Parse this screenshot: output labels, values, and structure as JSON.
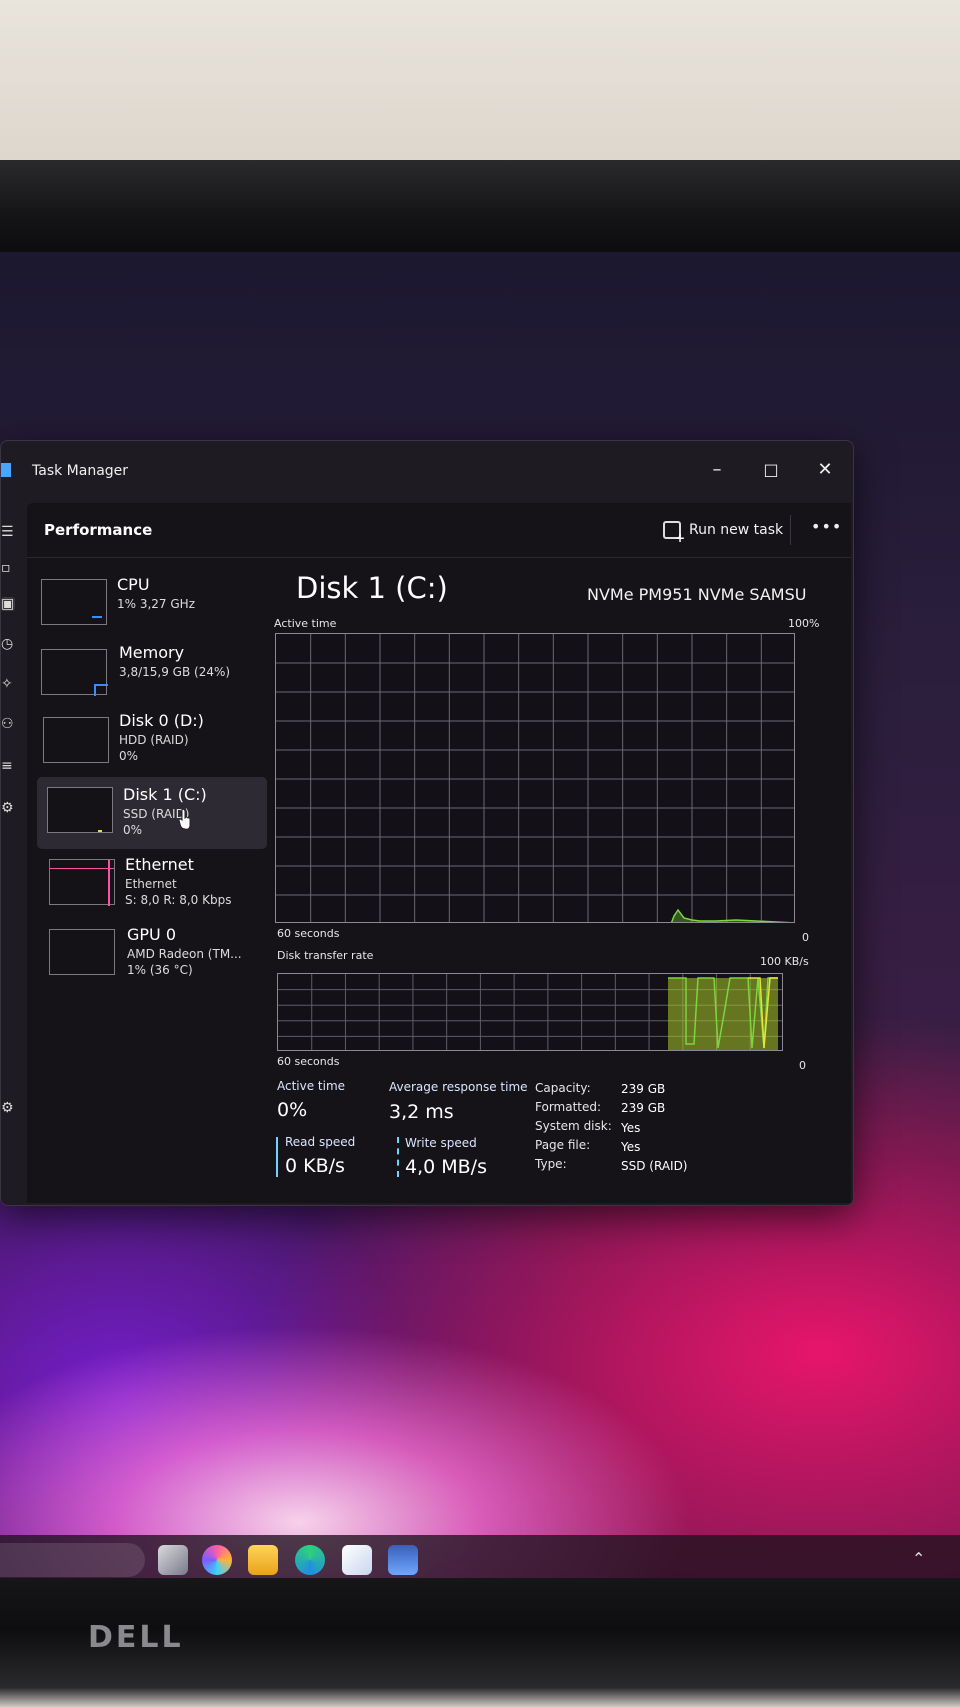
{
  "window": {
    "title": "Task Manager",
    "controls": {
      "minimize": "–",
      "maximize": "□",
      "close": "✕"
    }
  },
  "header": {
    "page_title": "Performance",
    "run_new_task": "Run new task",
    "more": "•••"
  },
  "sidebar": {
    "items": [
      {
        "name": "CPU",
        "sub1": "1% 3,27 GHz",
        "sub2": ""
      },
      {
        "name": "Memory",
        "sub1": "3,8/15,9 GB (24%)",
        "sub2": ""
      },
      {
        "name": "Disk 0 (D:)",
        "sub1": "HDD (RAID)",
        "sub2": "0%"
      },
      {
        "name": "Disk 1 (C:)",
        "sub1": "SSD (RAID)",
        "sub2": "0%"
      },
      {
        "name": "Ethernet",
        "sub1": "Ethernet",
        "sub2": "S: 8,0 R: 8,0 Kbps"
      },
      {
        "name": "GPU 0",
        "sub1": "AMD Radeon (TM...",
        "sub2": "1% (36 °C)"
      }
    ],
    "selected_index": 3
  },
  "main": {
    "disk_title": "Disk 1 (C:)",
    "disk_model": "NVMe PM951 NVMe SAMSU",
    "active_time_graph": {
      "label": "Active time",
      "max_label": "100%",
      "x_label": "60 seconds",
      "min_label": "0"
    },
    "transfer_graph": {
      "label": "Disk transfer rate",
      "max_label": "100 KB/s",
      "x_label": "60 seconds",
      "min_label": "0"
    },
    "stats": {
      "active_time_label": "Active time",
      "active_time_value": "0%",
      "avg_response_label": "Average response time",
      "avg_response_value": "3,2 ms",
      "read_speed_label": "Read speed",
      "read_speed_value": "0 KB/s",
      "write_speed_label": "Write speed",
      "write_speed_value": "4,0 MB/s"
    },
    "properties": [
      {
        "key": "Capacity:",
        "value": "239 GB"
      },
      {
        "key": "Formatted:",
        "value": "239 GB"
      },
      {
        "key": "System disk:",
        "value": "Yes"
      },
      {
        "key": "Page file:",
        "value": "Yes"
      },
      {
        "key": "Type:",
        "value": "SSD (RAID)"
      }
    ]
  },
  "monitor": {
    "brand": "DELL"
  },
  "colors": {
    "accent": "#3c8cff",
    "graph_green": "#7dd63c",
    "graph_yellow": "#e8e23a",
    "stat_bar": "#6bd6ff"
  }
}
